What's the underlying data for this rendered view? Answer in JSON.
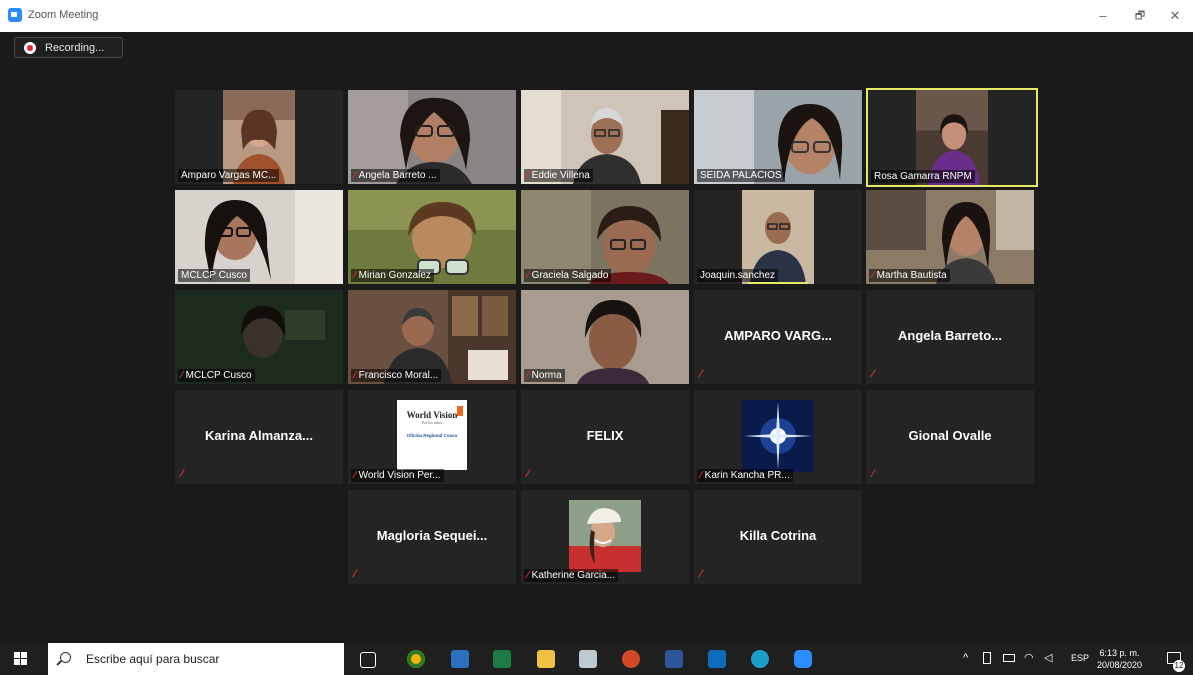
{
  "window": {
    "title": "Zoom Meeting",
    "minimize": "–",
    "maximize": "🗗",
    "close": "✕"
  },
  "recording": {
    "label": "Recording..."
  },
  "participants": [
    {
      "name": "Amparo Vargas MC...",
      "muted": false,
      "video": true
    },
    {
      "name": "Angela Barreto ...",
      "muted": true,
      "video": true
    },
    {
      "name": "Eddie Villena",
      "muted": true,
      "video": true
    },
    {
      "name": "SEIDA PALACIOS",
      "muted": false,
      "video": true
    },
    {
      "name": "Rosa Gamarra RNPM",
      "muted": false,
      "video": true,
      "active_speaker": true
    },
    {
      "name": "MCLCP Cusco",
      "muted": false,
      "video": true
    },
    {
      "name": "Mirian Gonzalez",
      "muted": true,
      "video": true
    },
    {
      "name": "Graciela Salgado",
      "muted": true,
      "video": true
    },
    {
      "name": "Joaquin.sanchez",
      "muted": false,
      "video": true
    },
    {
      "name": "Martha Bautista",
      "muted": true,
      "video": true
    },
    {
      "name": "MCLCP Cusco",
      "muted": true,
      "video": true
    },
    {
      "name": "Francisco Moral...",
      "muted": true,
      "video": true
    },
    {
      "name": "Norma",
      "muted": true,
      "video": true
    },
    {
      "name": "AMPARO VARG...",
      "muted": true,
      "video": false
    },
    {
      "name": "Angela Barreto...",
      "muted": true,
      "video": false
    },
    {
      "name": "Karina Almanza...",
      "muted": true,
      "video": false
    },
    {
      "name": "World Vision Per...",
      "muted": true,
      "video": true,
      "logo_lines": [
        "World Vision",
        "Por los niños",
        "Oficina Regional Cusco"
      ]
    },
    {
      "name": "FELIX",
      "muted": true,
      "video": false
    },
    {
      "name": "Karin Kancha PR...",
      "muted": true,
      "video": true
    },
    {
      "name": "Gional Ovalle",
      "muted": true,
      "video": false
    },
    {
      "name": "Magloria Sequei...",
      "muted": true,
      "video": false
    },
    {
      "name": "Katherine Garcia...",
      "muted": true,
      "video": true
    },
    {
      "name": "Killa Cotrina",
      "muted": true,
      "video": false
    }
  ],
  "taskbar": {
    "search_placeholder": "Escribe aquí para buscar",
    "language": "ESP",
    "time": "6:13 p. m.",
    "date": "20/08/2020",
    "notification_count": "12"
  },
  "colors": {
    "active_border": "#e6ea63",
    "muted_icon": "#e0332e",
    "tile_bg": "#242424"
  }
}
